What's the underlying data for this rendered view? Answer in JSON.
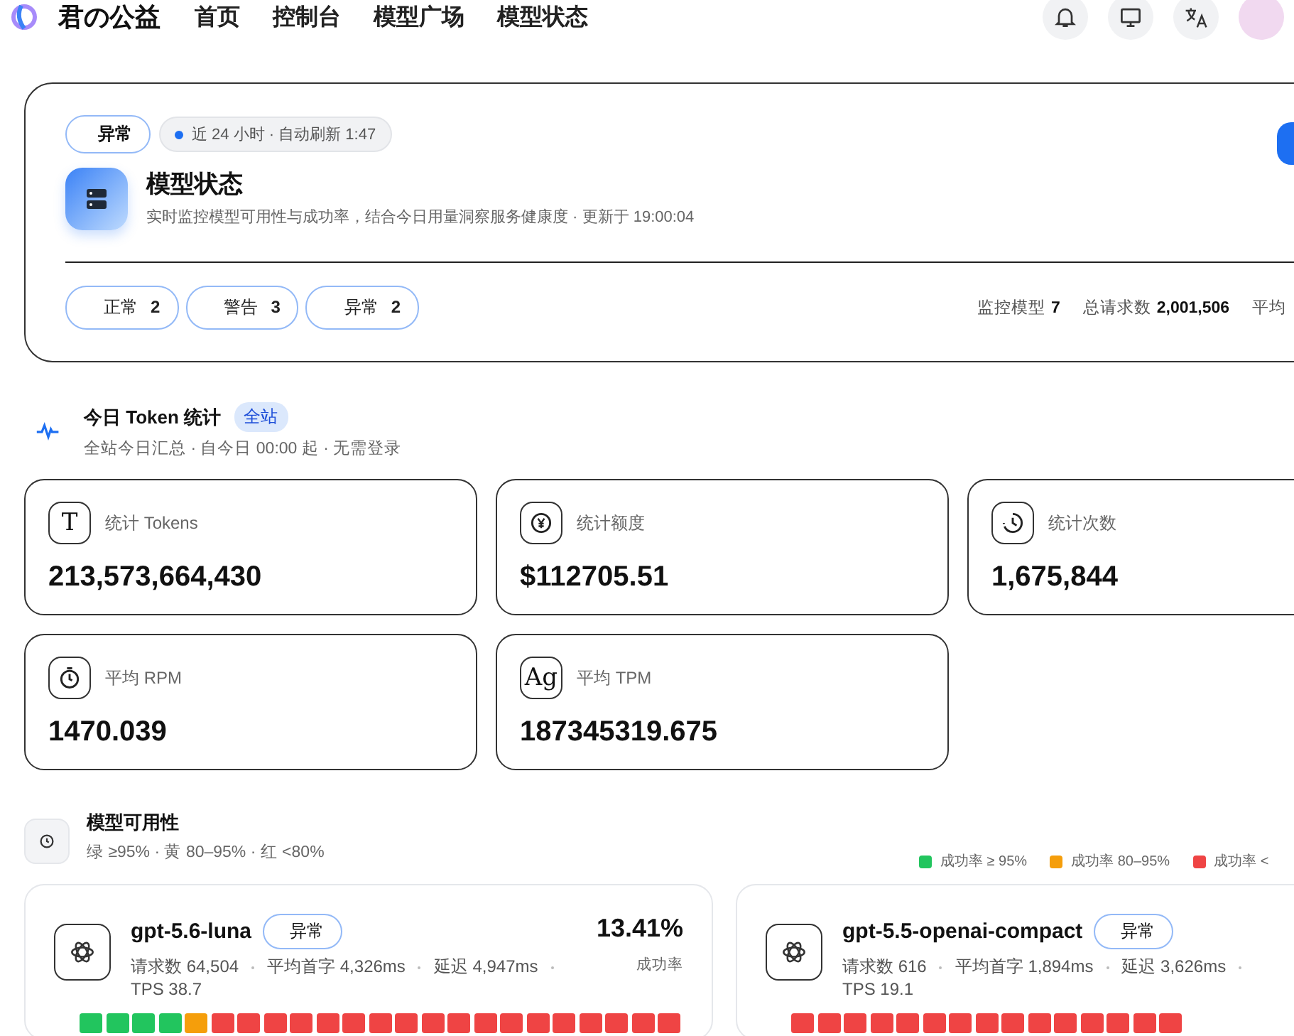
{
  "nav": {
    "brand": "君の公益",
    "links": [
      "首页",
      "控制台",
      "模型广场",
      "模型状态"
    ]
  },
  "hero": {
    "status": "异常",
    "refresh": "近 24 小时 · 自动刷新 1:47",
    "title": "模型状态",
    "subtitle": "实时监控模型可用性与成功率，结合今日用量洞察服务健康度 · 更新于 19:00:04",
    "filters": [
      {
        "label": "正常",
        "count": "2"
      },
      {
        "label": "警告",
        "count": "3"
      },
      {
        "label": "异常",
        "count": "2"
      }
    ],
    "stats": [
      {
        "label": "监控模型",
        "value": "7"
      },
      {
        "label": "总请求数",
        "value": "2,001,506"
      },
      {
        "label": "平均"
      }
    ]
  },
  "token": {
    "title": "今日 Token 统计",
    "badge": "全站",
    "subtitle": "全站今日汇总 · 自今日 00:00 起 · 无需登录",
    "cards": [
      {
        "kind": "glyph",
        "glyph": "T",
        "label": "统计 Tokens",
        "value": "213,573,664,430"
      },
      {
        "kind": "yen",
        "label": "统计额度",
        "value": "$112705.51"
      },
      {
        "kind": "history",
        "label": "统计次数",
        "value": "1,675,844"
      },
      {
        "kind": "stopwatch",
        "label": "平均 RPM",
        "value": "1470.039"
      },
      {
        "kind": "glyph",
        "glyph": "Ag",
        "label": "平均 TPM",
        "value": "187345319.675"
      }
    ]
  },
  "availability": {
    "title": "模型可用性",
    "subtitle": "绿 ≥95% · 黄 80–95% · 红 <80%",
    "legend": [
      {
        "label": "成功率 ≥ 95%",
        "color": "#22c55e"
      },
      {
        "label": "成功率 80–95%",
        "color": "#f59e0b"
      },
      {
        "label": "成功率 <",
        "color": "#ef4444"
      }
    ],
    "models": [
      {
        "name": "gpt-5.6-luna",
        "status": "异常",
        "stats": [
          "请求数 64,504",
          "平均首字 4,326ms",
          "延迟 4,947ms"
        ],
        "tps": "TPS 38.7",
        "rate": "13.41%",
        "rate_label": "成功率",
        "segments": [
          {
            "color": "#22c55e"
          },
          {
            "color": "#22c55e"
          },
          {
            "color": "#22c55e"
          },
          {
            "color": "#22c55e"
          },
          {
            "color": "#f59e0b"
          },
          {
            "color": "#ef4444"
          },
          {
            "color": "#ef4444"
          },
          {
            "color": "#ef4444"
          },
          {
            "color": "#ef4444"
          },
          {
            "color": "#ef4444"
          },
          {
            "color": "#ef4444"
          },
          {
            "color": "#ef4444"
          },
          {
            "color": "#ef4444"
          },
          {
            "color": "#ef4444"
          },
          {
            "color": "#ef4444"
          },
          {
            "color": "#ef4444"
          },
          {
            "color": "#ef4444"
          },
          {
            "color": "#ef4444"
          },
          {
            "color": "#ef4444"
          },
          {
            "color": "#ef4444"
          },
          {
            "color": "#ef4444"
          },
          {
            "color": "#ef4444"
          },
          {
            "color": "#ef4444"
          }
        ]
      },
      {
        "name": "gpt-5.5-openai-compact",
        "status": "异常",
        "stats": [
          "请求数 616",
          "平均首字 1,894ms",
          "延迟 3,626ms"
        ],
        "tps": "TPS 19.1",
        "segments": [
          {
            "color": "#ef4444"
          },
          {
            "color": "#ef4444"
          },
          {
            "color": "#ef4444"
          },
          {
            "color": "#ef4444"
          },
          {
            "color": "#ef4444"
          },
          {
            "color": "#ef4444"
          },
          {
            "color": "#ef4444"
          },
          {
            "color": "#ef4444"
          },
          {
            "color": "#ef4444"
          },
          {
            "color": "#ef4444"
          },
          {
            "color": "#ef4444"
          },
          {
            "color": "#ef4444"
          },
          {
            "color": "#ef4444"
          },
          {
            "color": "#ef4444"
          },
          {
            "color": "#ef4444"
          }
        ]
      }
    ]
  }
}
